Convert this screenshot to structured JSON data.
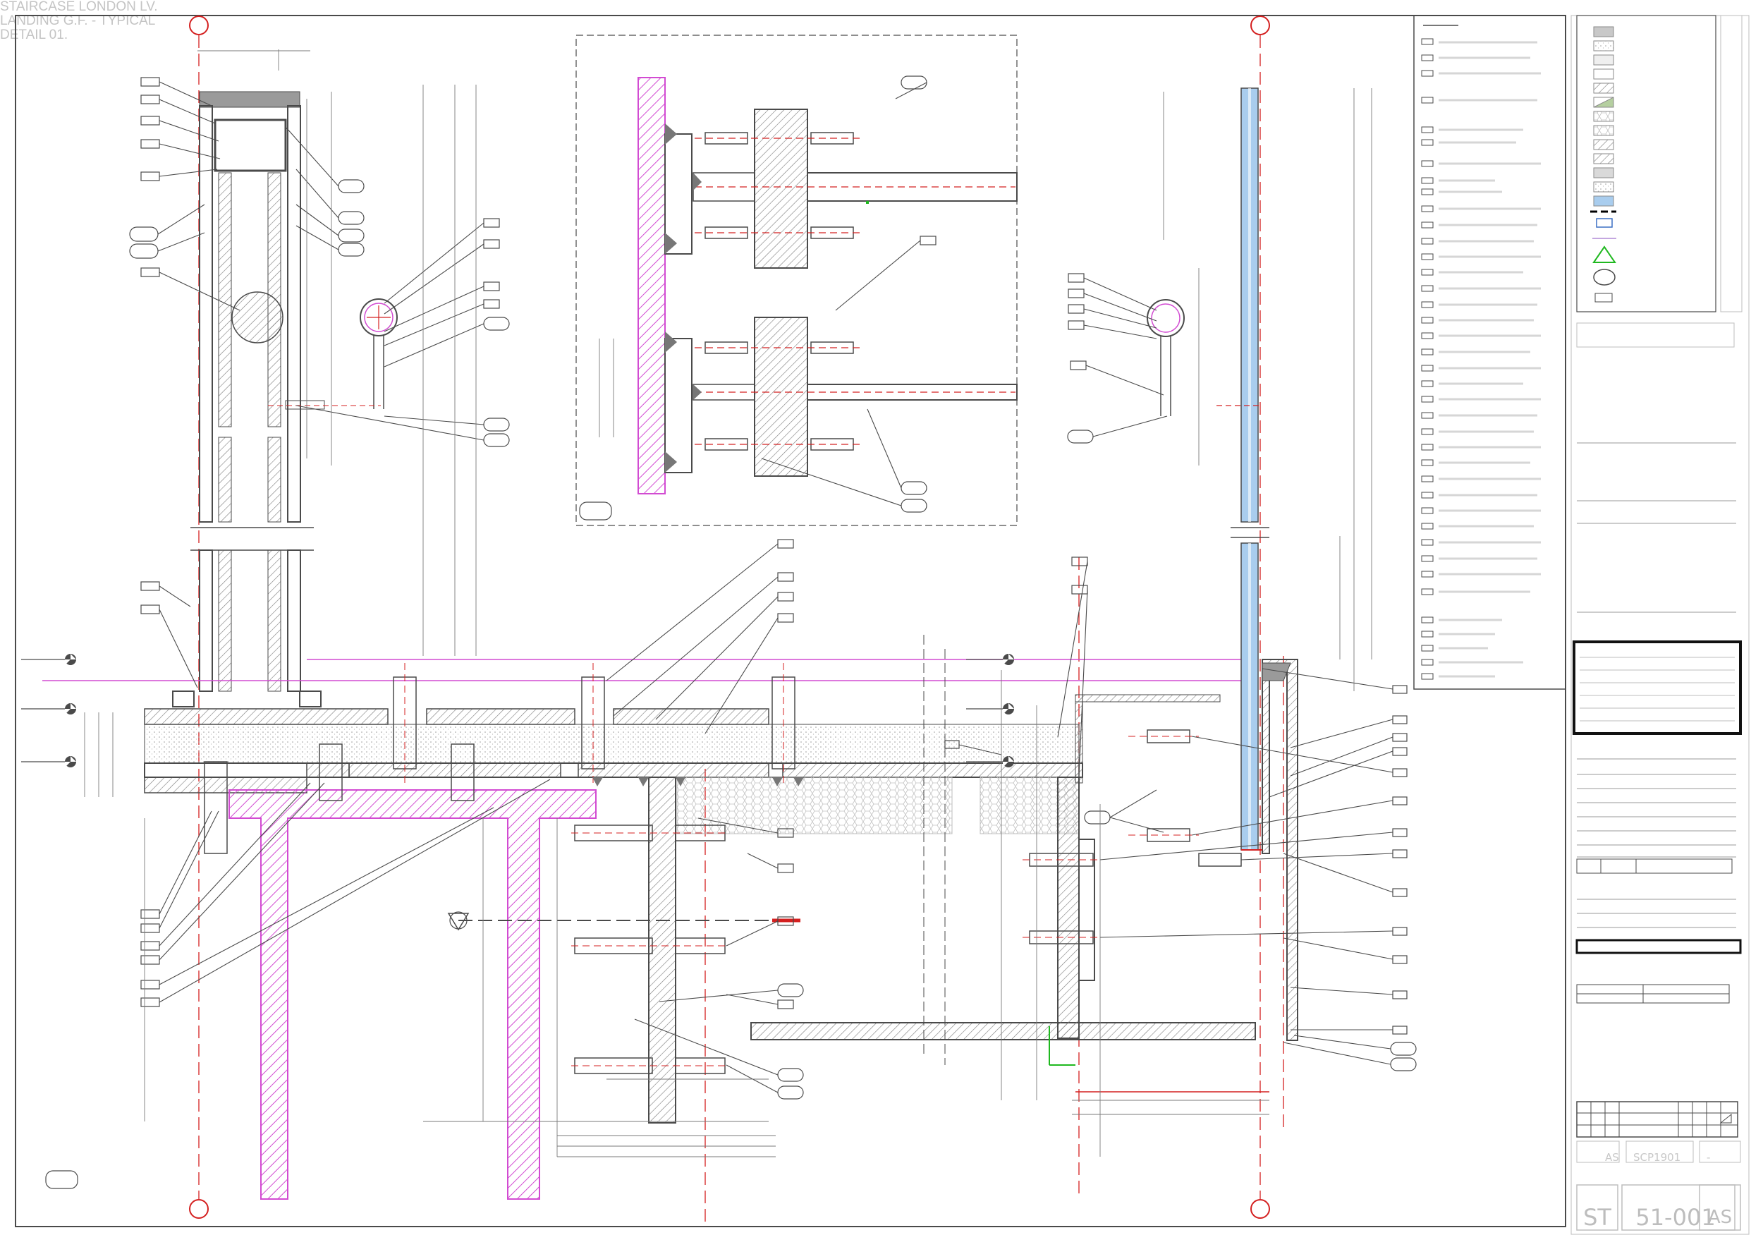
{
  "title_block": {
    "heading_lines": [
      "STAIRCASE LONDON LV.",
      "LANDING G.F. - TYPICAL",
      "DETAIL 01."
    ],
    "drawing_type": "ST",
    "drawing_number": "51-001",
    "revision": "AS",
    "drawn_by": "AS",
    "project_number": "SCP1901",
    "checked_by": "-"
  },
  "colors": {
    "linework": "#4a4a4a",
    "light_linework": "#9a9a9a",
    "magenta_hatch": "#d24bd2",
    "glass_blue": "#a9cdee",
    "center_line_red": "#d42020",
    "grid_bubble_red": "#d42020",
    "green_marker": "#1fb81f",
    "faint_text": "#c6c6c6"
  }
}
